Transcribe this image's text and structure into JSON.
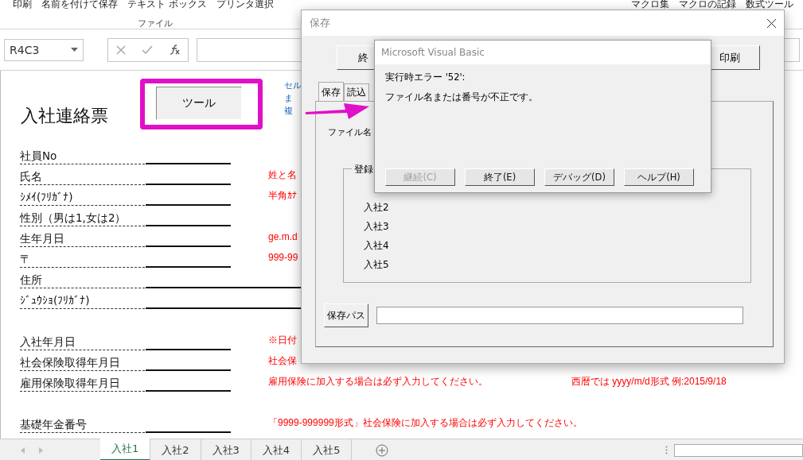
{
  "ribbon": {
    "left_commands": [
      "印刷",
      "名前を付けて保存",
      "テキスト ボックス",
      "プリンタ選択"
    ],
    "right_commands": [
      "マクロ集",
      "マクロの記録",
      "数式ツール"
    ],
    "group_label": "ファイル"
  },
  "formula_bar": {
    "name_box": "R4C3"
  },
  "sheet": {
    "title": "入社連絡票",
    "tool_button": "ツール",
    "links": [
      "セル",
      "ま",
      "複"
    ],
    "field_groups": [
      [
        {
          "label": "社員No",
          "wide": false
        },
        {
          "label": "氏名",
          "wide": false,
          "note": "姓と名"
        },
        {
          "label": "ｼﾒｲ(ﾌﾘｶﾞﾅ)",
          "wide": false,
          "note": "半角ｶﾅ"
        },
        {
          "label": "性別（男は1,女は2）",
          "wide": false
        },
        {
          "label": "生年月日",
          "wide": false,
          "note": "ge.m.d"
        },
        {
          "label": "〒",
          "wide": false,
          "note": "999-99"
        },
        {
          "label": "住所",
          "wide": true
        },
        {
          "label": "ｼﾞｭｳｼｮ(ﾌﾘｶﾞﾅ)",
          "wide": true
        }
      ],
      [
        {
          "label": "入社年月日",
          "wide": false,
          "note": "※日付"
        },
        {
          "label": "社会保険取得年月日",
          "wide": false,
          "note": "社会保"
        },
        {
          "label": "雇用保険取得年月日",
          "wide": false,
          "note": "雇用保険に加入する場合は必ず入力してください。",
          "note_2": "西暦では yyyy/m/d形式 例:2015/9/18"
        }
      ],
      [
        {
          "label": "基礎年金番号",
          "wide": false,
          "note": "「9999-999999形式」社会保険に加入する場合は必ず入力してください。"
        }
      ]
    ]
  },
  "sheet_tabs": [
    {
      "label": "入社1",
      "selected": true
    },
    {
      "label": "入社2",
      "selected": false
    },
    {
      "label": "入社3",
      "selected": false
    },
    {
      "label": "入社4",
      "selected": false
    },
    {
      "label": "入社5",
      "selected": false
    }
  ],
  "save_dialog": {
    "title": "保存",
    "buttons": [
      "終",
      "印刷"
    ],
    "tabs": [
      {
        "label": "保存",
        "selected": true
      },
      {
        "label": "読込",
        "selected": false
      }
    ],
    "file_name_label": "ファイル名",
    "group_label": "登録",
    "items": [
      "入社2",
      "入社3",
      "入社4",
      "入社5"
    ],
    "path_button": "保存パス"
  },
  "error_dialog": {
    "title": "Microsoft Visual Basic",
    "lines": [
      "実行時エラー '52':",
      "ファイル名または番号が不正です。"
    ],
    "buttons": [
      {
        "label": "継続(C)",
        "disabled": true
      },
      {
        "label": "終了(E)",
        "disabled": false
      },
      {
        "label": "デバッグ(D)",
        "disabled": false
      },
      {
        "label": "ヘルプ(H)",
        "disabled": false
      }
    ]
  }
}
